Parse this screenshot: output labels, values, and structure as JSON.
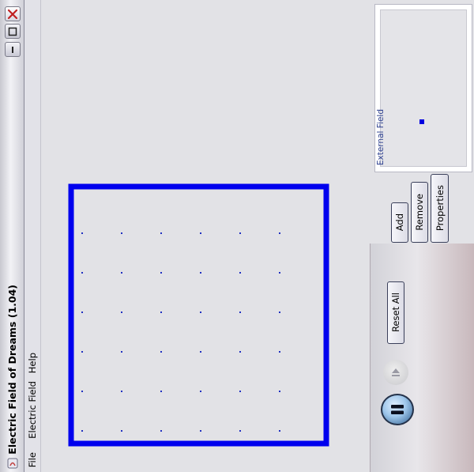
{
  "window": {
    "title": "Electric Field of Dreams (1.04)"
  },
  "menu": [
    {
      "label": "File"
    },
    {
      "label": "Electric Field"
    },
    {
      "label": "Help"
    }
  ],
  "external_field": {
    "label": "External Field"
  },
  "buttons": {
    "add": "Add",
    "remove": "Remove",
    "properties": "Properties",
    "reset_all": "Reset All"
  },
  "colors": {
    "field_border": "#0000ee",
    "grid_dot": "#2030c0",
    "background": "#e2e2e6"
  },
  "icons": {
    "close": "close-icon",
    "maximize": "maximize-icon",
    "minimize": "minimize-icon",
    "eject": "eject-icon",
    "pause": "pause-icon"
  }
}
